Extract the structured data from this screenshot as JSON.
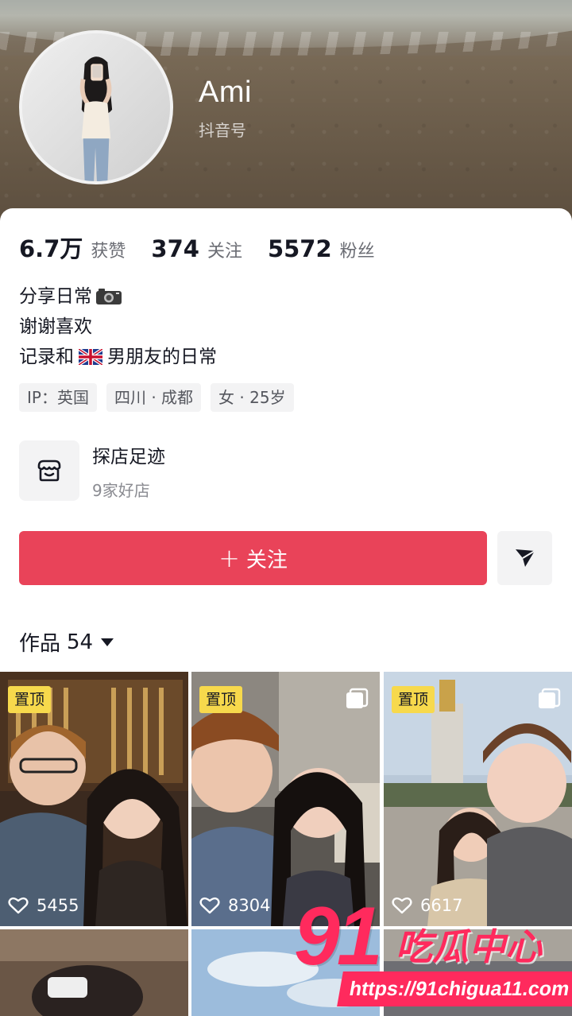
{
  "profile": {
    "name": "Ami",
    "douyin_id_label": "抖音号"
  },
  "stats": [
    {
      "value": "6.7万",
      "label": "获赞"
    },
    {
      "value": "374",
      "label": "关注"
    },
    {
      "value": "5572",
      "label": "粉丝"
    }
  ],
  "bio": {
    "line1": "分享日常",
    "line2": "谢谢喜欢",
    "line3_before": "记录和",
    "line3_after": "男朋友的日常"
  },
  "tags": [
    "IP：英国",
    "四川 · 成都",
    "女 · 25岁"
  ],
  "visit": {
    "title": "探店足迹",
    "subtitle": "9家好店"
  },
  "actions": {
    "follow_plus": "+",
    "follow_label": "关注"
  },
  "works": {
    "label": "作品",
    "count": "54"
  },
  "tiles": [
    {
      "pinned": "置顶",
      "likes": "5455"
    },
    {
      "pinned": "置顶",
      "likes": "8304"
    },
    {
      "pinned": "置顶",
      "likes": "6617"
    }
  ],
  "watermark": {
    "number": "91",
    "text": "吃瓜中心",
    "url": "https://91chigua11.com"
  },
  "colors": {
    "accent": "#e94359",
    "pin_badge": "#f7d94c",
    "watermark": "#ff2a5d"
  }
}
